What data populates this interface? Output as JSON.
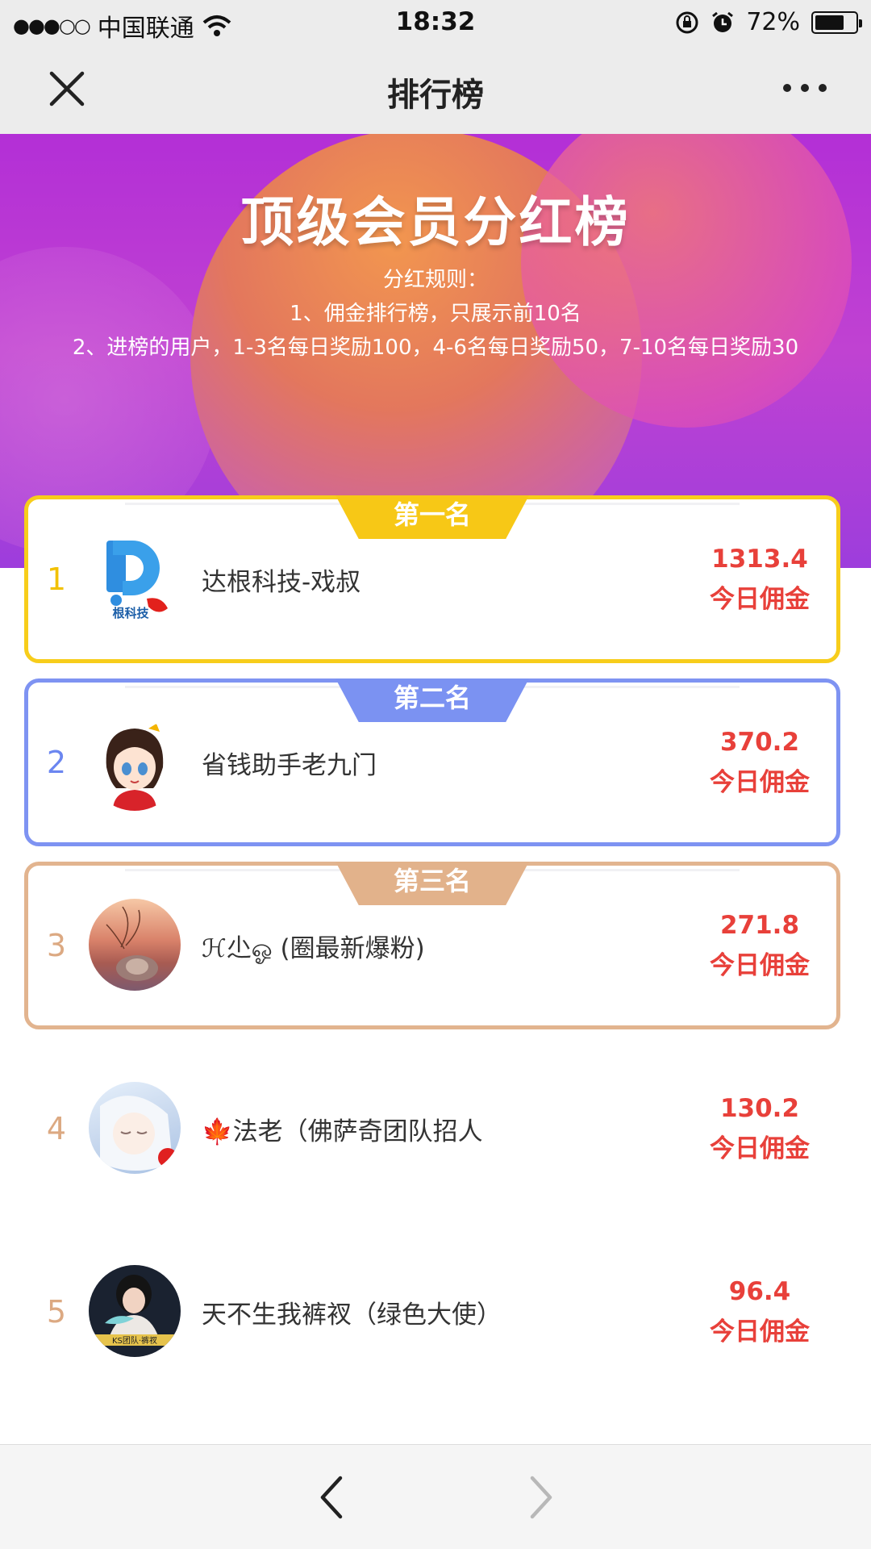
{
  "status_bar": {
    "signal": "●●●○○",
    "carrier": "中国联通",
    "time": "18:32",
    "battery": "72%",
    "battery_level": 0.72
  },
  "nav": {
    "title": "排行榜",
    "close_icon": "close-icon",
    "more_icon": "more-icon"
  },
  "banner": {
    "title": "顶级会员分红榜",
    "rules_heading": "分红规则：",
    "rule_1": "1、佣金排行榜，只展示前10名",
    "rule_2": "2、进榜的用户，1-3名每日奖励100，4-6名每日奖励50，7-10名每日奖励30"
  },
  "amount_label": "今日佣金",
  "ranks": [
    {
      "rank": "1",
      "tab": "第一名",
      "name": "达根科技-戏叔",
      "amount": "1313.4",
      "rank_color": "#f2c100"
    },
    {
      "rank": "2",
      "tab": "第二名",
      "name": "省钱助手老九门",
      "amount": "370.2",
      "rank_color": "#6b86f0"
    },
    {
      "rank": "3",
      "tab": "第三名",
      "name": "ℋ尐ஓ (圈最新爆粉)",
      "amount": "271.8",
      "rank_color": "#dca982"
    },
    {
      "rank": "4",
      "name": "🍁法老（佛萨奇团队招人",
      "amount": "130.2",
      "rank_color": "#dca982"
    },
    {
      "rank": "5",
      "name": "天不生我裤衩（绿色大使）",
      "amount": "96.4",
      "rank_color": "#dca982"
    }
  ],
  "avatars": {
    "a1_text": "根科技",
    "a5_text": "KS团队·裤衩"
  },
  "toolbar": {
    "back_icon": "chevron-left-icon",
    "forward_icon": "chevron-right-icon"
  }
}
